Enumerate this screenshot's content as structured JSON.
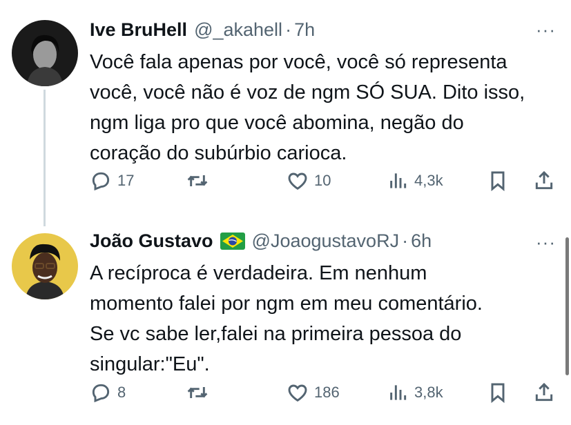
{
  "tweets": [
    {
      "name": "Ive BruHell",
      "handle": "@_akahell",
      "separator": "·",
      "time": "7h",
      "text_lines": [
        "Você fala apenas por você, você só representa",
        "você, você não é voz de ngm SÓ SUA. Dito isso,",
        "ngm liga pro que você abomina, negão do",
        "coração do subúrbio carioca."
      ],
      "replies": "17",
      "retweets": "",
      "likes": "10",
      "views": "4,3k"
    },
    {
      "name": "João Gustavo",
      "flag": "brazil-flag",
      "handle": "@JoaogustavoRJ",
      "separator": "·",
      "time": "6h",
      "text_lines": [
        "A recíproca é verdadeira. Em nenhum",
        "momento falei por ngm em meu comentário.",
        "Se vc sabe ler,falei na primeira pessoa do",
        "singular:\"Eu\"."
      ],
      "replies": "8",
      "retweets": "",
      "likes": "186",
      "views": "3,8k"
    }
  ],
  "more_label": "···",
  "colors": {
    "secondary_text": "#536471",
    "thread_line": "#cfd9de"
  },
  "icons": [
    "reply-icon",
    "retweet-icon",
    "like-icon",
    "views-icon",
    "bookmark-icon",
    "share-icon"
  ]
}
